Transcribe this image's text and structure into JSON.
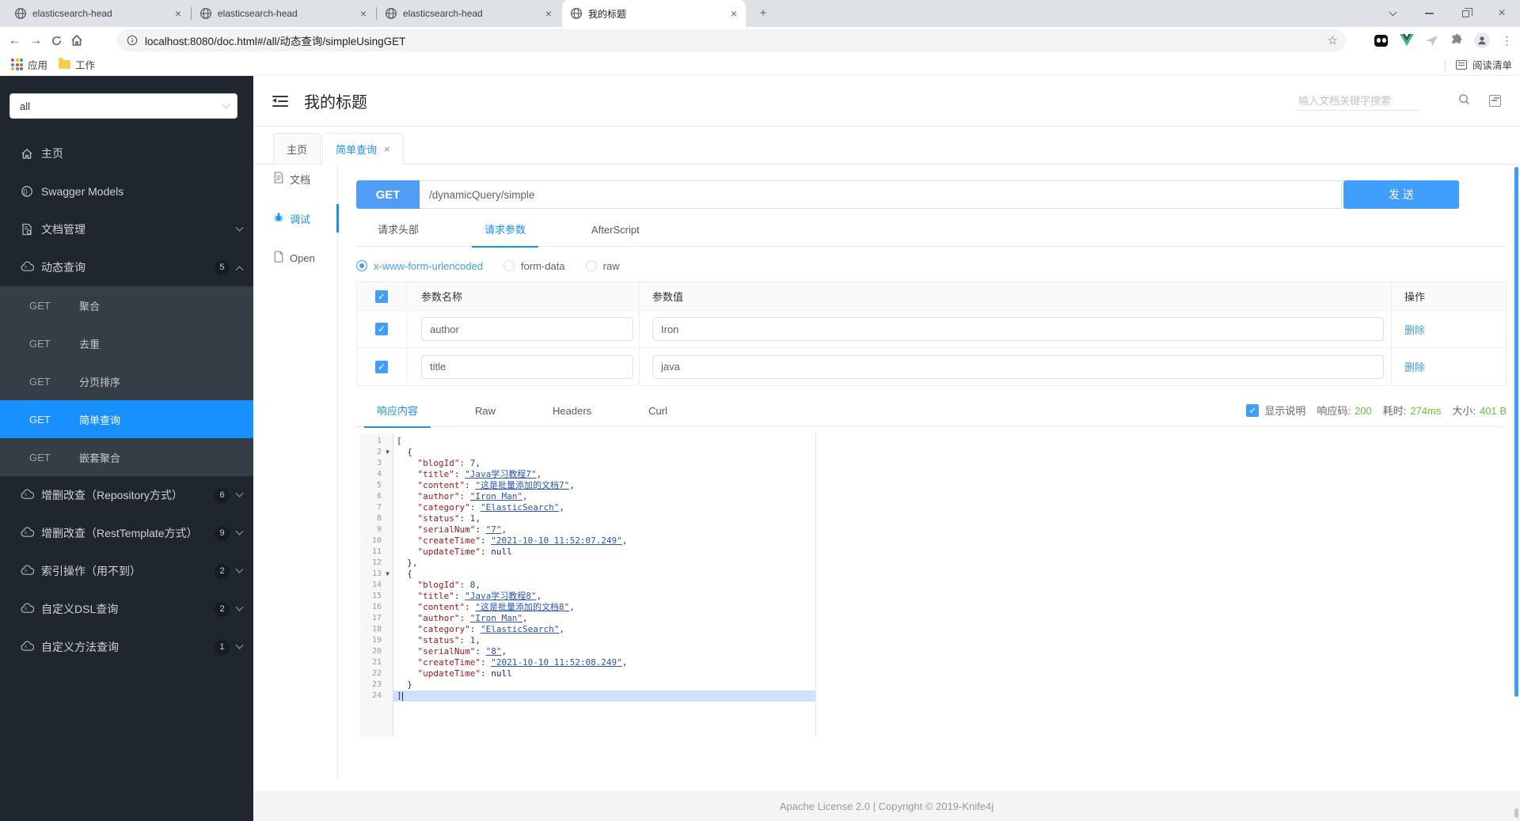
{
  "colors": {
    "accent": "#1890ff",
    "primary": "#409eff",
    "success": "#67c23a",
    "method_get": "#509df5"
  },
  "browser": {
    "tabs": [
      {
        "title": "elasticsearch-head",
        "active": false
      },
      {
        "title": "elasticsearch-head",
        "active": false
      },
      {
        "title": "elasticsearch-head",
        "active": false
      },
      {
        "title": "我的标题",
        "active": true
      }
    ],
    "new_tab_label": "+",
    "url": "localhost:8080/doc.html#/all/动态查询/simpleUsingGET",
    "bookmarks_left": [
      {
        "label": "应用",
        "icon": "apps-grid-icon"
      },
      {
        "label": "工作",
        "icon": "folder-icon"
      }
    ],
    "reading_list": "阅读清单"
  },
  "sidebar": {
    "group_select": {
      "value": "all"
    },
    "items": [
      {
        "id": "home",
        "label": "主页",
        "icon": "home"
      },
      {
        "id": "swagger-models",
        "label": "Swagger Models",
        "icon": "swagger"
      },
      {
        "id": "doc-manage",
        "label": "文档管理",
        "icon": "docgear",
        "chevron": "down"
      },
      {
        "id": "dynamic-query",
        "label": "动态查询",
        "icon": "cloud",
        "badge": "5",
        "chevron": "up",
        "expanded": true,
        "children": [
          {
            "method": "GET",
            "label": "聚合",
            "active": false
          },
          {
            "method": "GET",
            "label": "去重",
            "active": false
          },
          {
            "method": "GET",
            "label": "分页排序",
            "active": false
          },
          {
            "method": "GET",
            "label": "简单查询",
            "active": true
          },
          {
            "method": "GET",
            "label": "嵌套聚合",
            "active": false
          }
        ]
      },
      {
        "id": "crud-repository",
        "label": "增删改查（Repository方式）",
        "icon": "cloud",
        "badge": "6",
        "chevron": "down"
      },
      {
        "id": "crud-resttemplate",
        "label": "增删改查（RestTemplate方式）",
        "icon": "cloud",
        "badge": "9",
        "chevron": "down"
      },
      {
        "id": "index-ops",
        "label": "索引操作（用不到）",
        "icon": "cloud",
        "badge": "2",
        "chevron": "down"
      },
      {
        "id": "custom-dsl",
        "label": "自定义DSL查询",
        "icon": "cloud",
        "badge": "2",
        "chevron": "down"
      },
      {
        "id": "custom-method",
        "label": "自定义方法查询",
        "icon": "cloud",
        "badge": "1",
        "chevron": "down"
      }
    ]
  },
  "header": {
    "title": "我的标题",
    "search_placeholder": "输入文档关键字搜索"
  },
  "doc_tabs": [
    {
      "label": "主页",
      "active": false,
      "closable": false
    },
    {
      "label": "简单查询",
      "active": true,
      "closable": true
    }
  ],
  "mini_nav": [
    {
      "label": "文档",
      "icon": "doc",
      "active": false
    },
    {
      "label": "调试",
      "icon": "debug",
      "active": true
    },
    {
      "label": "Open",
      "icon": "open",
      "active": false
    }
  ],
  "request": {
    "method": "GET",
    "url": "/dynamicQuery/simple",
    "send_label": "发 送"
  },
  "request_tabs": [
    {
      "label": "请求头部",
      "active": false
    },
    {
      "label": "请求参数",
      "active": true
    },
    {
      "label": "AfterScript",
      "active": false
    }
  ],
  "body_types": [
    {
      "label": "x-www-form-urlencoded",
      "selected": true
    },
    {
      "label": "form-data",
      "selected": false
    },
    {
      "label": "raw",
      "selected": false
    }
  ],
  "params_table": {
    "columns": [
      "参数名称",
      "参数值",
      "操作"
    ],
    "rows": [
      {
        "checked": true,
        "name": "author",
        "value": "Iron",
        "action": "删除"
      },
      {
        "checked": true,
        "name": "title",
        "value": "java",
        "action": "删除"
      }
    ]
  },
  "response_tabs": [
    {
      "label": "响应内容",
      "active": true
    },
    {
      "label": "Raw",
      "active": false
    },
    {
      "label": "Headers",
      "active": false
    },
    {
      "label": "Curl",
      "active": false
    }
  ],
  "response_meta": {
    "show_desc": {
      "checked": true,
      "label": "显示说明"
    },
    "items": [
      {
        "label": "响应码:",
        "value": "200"
      },
      {
        "label": "耗时:",
        "value": "274ms"
      },
      {
        "label": "大小:",
        "value": "401 B"
      }
    ]
  },
  "editor": {
    "lines": [
      {
        "n": 1,
        "tokens": [
          [
            "p",
            "["
          ]
        ]
      },
      {
        "n": 2,
        "fold": true,
        "tokens": [
          [
            "p",
            "  {"
          ]
        ]
      },
      {
        "n": 3,
        "tokens": [
          [
            "p",
            "    "
          ],
          [
            "k",
            "\"blogId\""
          ],
          [
            "p",
            ": "
          ],
          [
            "n",
            "7"
          ],
          [
            "p",
            ","
          ]
        ]
      },
      {
        "n": 4,
        "tokens": [
          [
            "p",
            "    "
          ],
          [
            "k",
            "\"title\""
          ],
          [
            "p",
            ": "
          ],
          [
            "s",
            "\"Java学习教程7\""
          ],
          [
            "p",
            ","
          ]
        ]
      },
      {
        "n": 5,
        "tokens": [
          [
            "p",
            "    "
          ],
          [
            "k",
            "\"content\""
          ],
          [
            "p",
            ": "
          ],
          [
            "s",
            "\"这是批量添加的文档7\""
          ],
          [
            "p",
            ","
          ]
        ]
      },
      {
        "n": 6,
        "tokens": [
          [
            "p",
            "    "
          ],
          [
            "k",
            "\"author\""
          ],
          [
            "p",
            ": "
          ],
          [
            "s",
            "\"Iron Man\""
          ],
          [
            "p",
            ","
          ]
        ]
      },
      {
        "n": 7,
        "tokens": [
          [
            "p",
            "    "
          ],
          [
            "k",
            "\"category\""
          ],
          [
            "p",
            ": "
          ],
          [
            "s",
            "\"ElasticSearch\""
          ],
          [
            "p",
            ","
          ]
        ]
      },
      {
        "n": 8,
        "tokens": [
          [
            "p",
            "    "
          ],
          [
            "k",
            "\"status\""
          ],
          [
            "p",
            ": "
          ],
          [
            "n",
            "1"
          ],
          [
            "p",
            ","
          ]
        ]
      },
      {
        "n": 9,
        "tokens": [
          [
            "p",
            "    "
          ],
          [
            "k",
            "\"serialNum\""
          ],
          [
            "p",
            ": "
          ],
          [
            "s",
            "\"7\""
          ],
          [
            "p",
            ","
          ]
        ]
      },
      {
        "n": 10,
        "tokens": [
          [
            "p",
            "    "
          ],
          [
            "k",
            "\"createTime\""
          ],
          [
            "p",
            ": "
          ],
          [
            "s",
            "\"2021-10-10 11:52:07.249\""
          ],
          [
            "p",
            ","
          ]
        ]
      },
      {
        "n": 11,
        "tokens": [
          [
            "p",
            "    "
          ],
          [
            "k",
            "\"updateTime\""
          ],
          [
            "p",
            ": "
          ],
          [
            "u",
            "null"
          ]
        ]
      },
      {
        "n": 12,
        "tokens": [
          [
            "p",
            "  },"
          ]
        ]
      },
      {
        "n": 13,
        "fold": true,
        "tokens": [
          [
            "p",
            "  {"
          ]
        ]
      },
      {
        "n": 14,
        "tokens": [
          [
            "p",
            "    "
          ],
          [
            "k",
            "\"blogId\""
          ],
          [
            "p",
            ": "
          ],
          [
            "n",
            "8"
          ],
          [
            "p",
            ","
          ]
        ]
      },
      {
        "n": 15,
        "tokens": [
          [
            "p",
            "    "
          ],
          [
            "k",
            "\"title\""
          ],
          [
            "p",
            ": "
          ],
          [
            "s",
            "\"Java学习教程8\""
          ],
          [
            "p",
            ","
          ]
        ]
      },
      {
        "n": 16,
        "tokens": [
          [
            "p",
            "    "
          ],
          [
            "k",
            "\"content\""
          ],
          [
            "p",
            ": "
          ],
          [
            "s",
            "\"这是批量添加的文档8\""
          ],
          [
            "p",
            ","
          ]
        ]
      },
      {
        "n": 17,
        "tokens": [
          [
            "p",
            "    "
          ],
          [
            "k",
            "\"author\""
          ],
          [
            "p",
            ": "
          ],
          [
            "s",
            "\"Iron Man\""
          ],
          [
            "p",
            ","
          ]
        ]
      },
      {
        "n": 18,
        "tokens": [
          [
            "p",
            "    "
          ],
          [
            "k",
            "\"category\""
          ],
          [
            "p",
            ": "
          ],
          [
            "s",
            "\"ElasticSearch\""
          ],
          [
            "p",
            ","
          ]
        ]
      },
      {
        "n": 19,
        "tokens": [
          [
            "p",
            "    "
          ],
          [
            "k",
            "\"status\""
          ],
          [
            "p",
            ": "
          ],
          [
            "n",
            "1"
          ],
          [
            "p",
            ","
          ]
        ]
      },
      {
        "n": 20,
        "tokens": [
          [
            "p",
            "    "
          ],
          [
            "k",
            "\"serialNum\""
          ],
          [
            "p",
            ": "
          ],
          [
            "s",
            "\"8\""
          ],
          [
            "p",
            ","
          ]
        ]
      },
      {
        "n": 21,
        "tokens": [
          [
            "p",
            "    "
          ],
          [
            "k",
            "\"createTime\""
          ],
          [
            "p",
            ": "
          ],
          [
            "s",
            "\"2021-10-10 11:52:08.249\""
          ],
          [
            "p",
            ","
          ]
        ]
      },
      {
        "n": 22,
        "tokens": [
          [
            "p",
            "    "
          ],
          [
            "k",
            "\"updateTime\""
          ],
          [
            "p",
            ": "
          ],
          [
            "u",
            "null"
          ]
        ]
      },
      {
        "n": 23,
        "tokens": [
          [
            "p",
            "  }"
          ]
        ]
      },
      {
        "n": 24,
        "sel": true,
        "tokens": [
          [
            "p",
            "]"
          ]
        ]
      }
    ]
  },
  "footer": {
    "text": "Apache License 2.0 | Copyright © 2019-Knife4j"
  }
}
